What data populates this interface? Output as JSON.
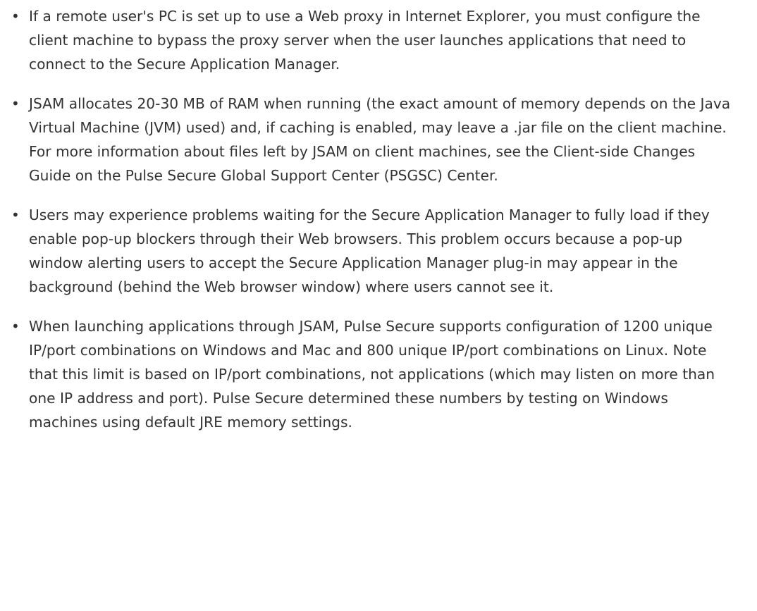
{
  "notes": [
    {
      "text": "If a remote user's PC is set up to use a Web proxy in Internet Explorer, you must configure the client machine to bypass the proxy server when the user launches applications that need to connect to the Secure Application Manager."
    },
    {
      "text": "JSAM allocates 20-30 MB of RAM when running (the exact amount of memory depends on the Java Virtual Machine (JVM) used) and, if caching is enabled, may leave a .jar file on the client machine. For more information about files left by JSAM on client machines, see the Client-side Changes Guide on the Pulse Secure Global Support Center (PSGSC) Center."
    },
    {
      "text": "Users may experience problems waiting for the Secure Application Manager to fully load if they enable pop-up blockers through their Web browsers. This problem occurs because a pop-up window alerting users to accept the Secure Application Manager plug-in may appear in the background (behind the Web browser window) where users cannot see it."
    },
    {
      "text": "When launching applications through JSAM, Pulse Secure supports configuration of 1200 unique IP/port combinations on Windows and Mac and 800 unique IP/port combinations on Linux. Note that this limit is based on IP/port combinations, not applications (which may listen on more than one IP address and port). Pulse Secure determined these numbers by testing on Windows machines using default JRE memory settings."
    }
  ]
}
